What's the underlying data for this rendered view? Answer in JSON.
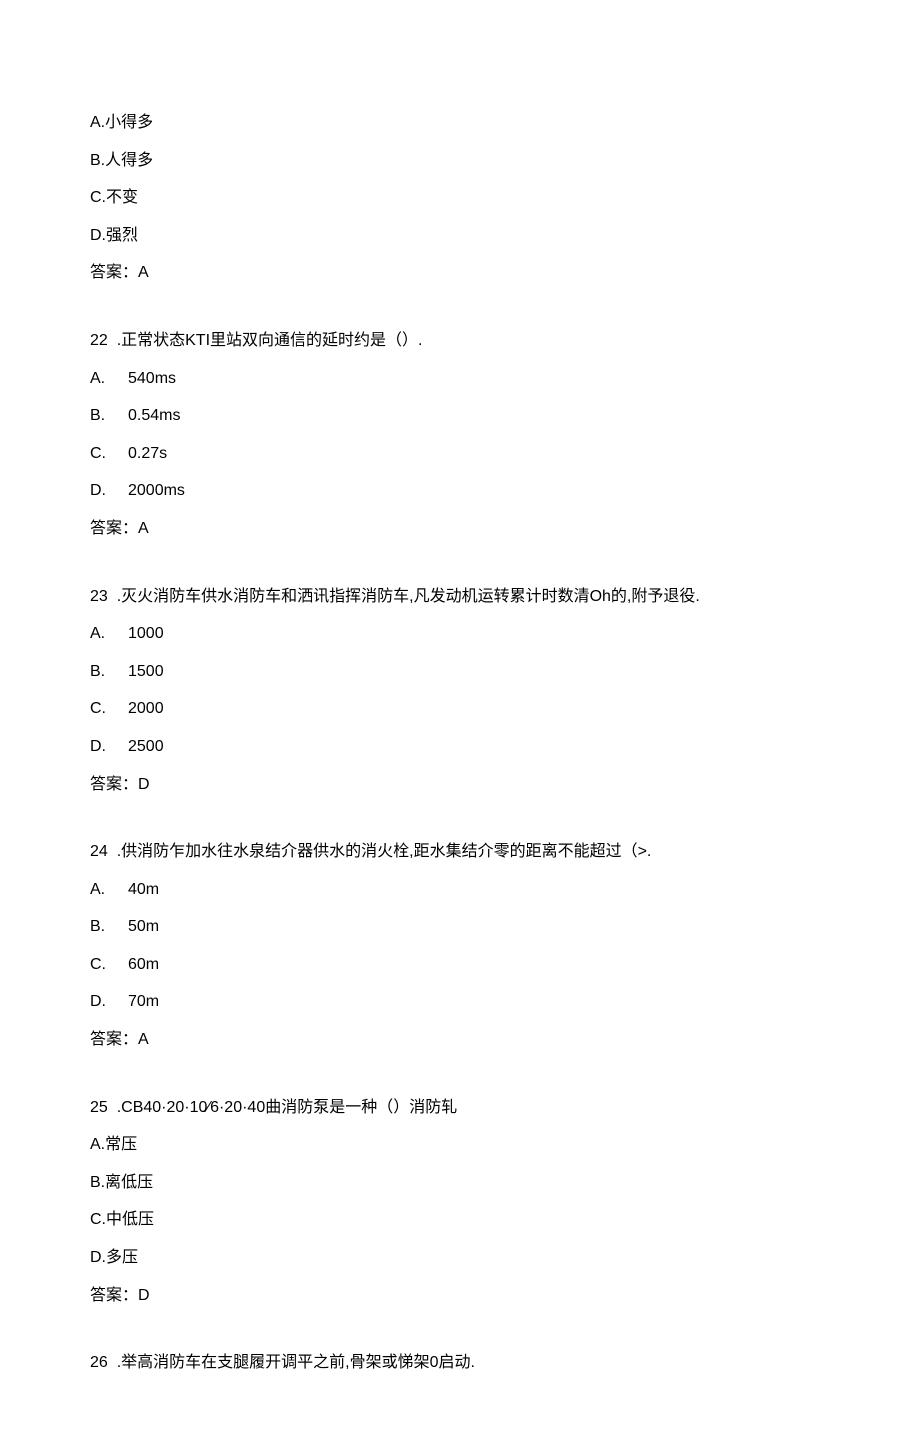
{
  "questions": [
    {
      "number": "",
      "stem": "",
      "options": [
        {
          "letter": "A.",
          "text": "小得多"
        },
        {
          "letter": "B.",
          "text": "人得多"
        },
        {
          "letter": "C.",
          "text": "不变"
        },
        {
          "letter": "D.",
          "text": "强烈"
        }
      ],
      "answer_label": "答案：",
      "answer": "A"
    },
    {
      "number": "22",
      "stem": ".正常状态KTI里站双向通信的延时约是（）.",
      "options": [
        {
          "letter": "A.",
          "text": "540ms"
        },
        {
          "letter": "B.",
          "text": "0.54ms"
        },
        {
          "letter": "C.",
          "text": "0.27s"
        },
        {
          "letter": "D.",
          "text": "2000ms"
        }
      ],
      "answer_label": "答案：",
      "answer": "A"
    },
    {
      "number": "23",
      "stem": ".灭火消防车供水消防车和洒讯指挥消防车,凡发动机运转累计时数清Oh的,附予退役.",
      "options": [
        {
          "letter": "A.",
          "text": "1000"
        },
        {
          "letter": "B.",
          "text": "1500"
        },
        {
          "letter": "C.",
          "text": "2000"
        },
        {
          "letter": "D.",
          "text": "2500"
        }
      ],
      "answer_label": "答案：",
      "answer": "D"
    },
    {
      "number": "24",
      "stem": ".供消防乍加水往水泉结介器供水的消火栓,距水集结介零的距离不能超过（>.",
      "options": [
        {
          "letter": "A.",
          "text": "40m"
        },
        {
          "letter": "B.",
          "text": "50m"
        },
        {
          "letter": "C.",
          "text": "60m"
        },
        {
          "letter": "D.",
          "text": "70m"
        }
      ],
      "answer_label": "答案：",
      "answer": "A"
    },
    {
      "number": "25",
      "stem": ".CB40·20·10⁄6·20·40曲消防泵是一种（）消防轧",
      "options": [
        {
          "letter": "A.",
          "text": "常压"
        },
        {
          "letter": "B.",
          "text": "离低压"
        },
        {
          "letter": "C.",
          "text": "中低压"
        },
        {
          "letter": "D.",
          "text": "多压"
        }
      ],
      "answer_label": "答案：",
      "answer": "D"
    },
    {
      "number": "26",
      "stem": ".举高消防车在支腿履开调平之前,骨架或悌架0启动.",
      "options": [],
      "answer_label": "",
      "answer": ""
    }
  ]
}
